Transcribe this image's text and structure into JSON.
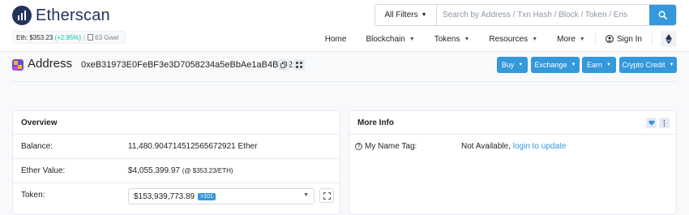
{
  "brand": {
    "name": "Etherscan"
  },
  "price": {
    "label": "Eth: $353.23",
    "change": "(+2.95%)",
    "separator": "|",
    "gas": "63 Gwei"
  },
  "search": {
    "filter": "All Filters",
    "placeholder": "Search by Address / Txn Hash / Block / Token / Ens"
  },
  "nav": {
    "home": "Home",
    "blockchain": "Blockchain",
    "tokens": "Tokens",
    "resources": "Resources",
    "more": "More",
    "signin": "Sign In"
  },
  "page": {
    "title": "Address",
    "address": "0xeB31973E0FeBF3e3D7058234a5eBbAe1aB4B8c23"
  },
  "actions": {
    "buy": "Buy",
    "exchange": "Exchange",
    "earn": "Earn",
    "crypto_credit": "Crypto Credit"
  },
  "overview": {
    "title": "Overview",
    "balance_label": "Balance:",
    "balance_value": "11,480.904714512565672921 Ether",
    "ether_value_label": "Ether Value:",
    "ether_value": "$4,055,399.97",
    "ether_value_note": "(@ $353.23/ETH)",
    "token_label": "Token:",
    "token_value": "$153,939,773.89",
    "token_badge": ">101"
  },
  "more_info": {
    "title": "More Info",
    "name_tag_label": "My Name Tag:",
    "name_tag_value": "Not Available,",
    "name_tag_link": "login to update"
  },
  "colors": {
    "accent": "#3498db",
    "positive": "#00c9a7",
    "brand": "#21325b"
  },
  "icons": [
    "search-icon",
    "gas-pump-icon",
    "user-circle-icon",
    "ethereum-icon",
    "copy-icon",
    "qr-code-icon",
    "expand-icon",
    "heart-icon",
    "kebab-icon",
    "question-circle-icon"
  ]
}
